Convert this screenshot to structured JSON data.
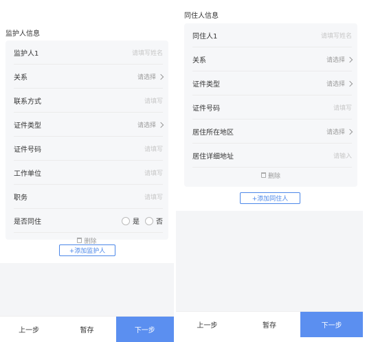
{
  "guardian": {
    "section_title": "监护人信息",
    "rows": [
      {
        "label": "监护人1",
        "value": "请填写姓名"
      },
      {
        "label": "关系",
        "value": "请选择"
      },
      {
        "label": "联系方式",
        "value": "请填写"
      },
      {
        "label": "证件类型",
        "value": "请选择"
      },
      {
        "label": "证件号码",
        "value": "请填写"
      },
      {
        "label": "工作单位",
        "value": "请填写"
      },
      {
        "label": "职务",
        "value": "请填写"
      }
    ],
    "cohabit": {
      "label": "是否同住",
      "yes": "是",
      "no": "否"
    },
    "delete_label": "删除",
    "add_label": "+添加监护人"
  },
  "cohabitant": {
    "section_title": "同住人信息",
    "rows": [
      {
        "label": "同住人1",
        "value": "请填写姓名"
      },
      {
        "label": "关系",
        "value": "请选择"
      },
      {
        "label": "证件类型",
        "value": "请选择"
      },
      {
        "label": "证件号码",
        "value": "请填写"
      },
      {
        "label": "居住所在地区",
        "value": "请选择"
      },
      {
        "label": "居住详细地址",
        "value": "请输入"
      }
    ],
    "delete_label": "删除",
    "add_label": "+添加同住人"
  },
  "footer": {
    "prev": "上一步",
    "save": "暂存",
    "next": "下一步"
  },
  "colors": {
    "primary": "#5b8ff0",
    "link": "#4a86e8",
    "background": "#f4f5f7"
  }
}
